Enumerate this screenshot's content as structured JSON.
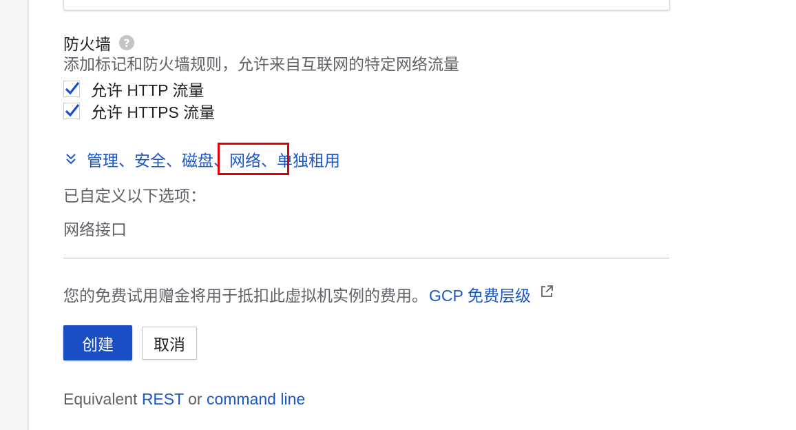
{
  "firewall": {
    "title": "防火墙",
    "help_icon": "help-icon",
    "description": "添加标记和防火墙规则，允许来自互联网的特定网络流量",
    "http_label": "允许 HTTP 流量",
    "http_checked": true,
    "https_label": "允许 HTTPS 流量",
    "https_checked": true
  },
  "advanced": {
    "expander_label": "管理、安全、磁盘、网络、单独租用",
    "chevron_icon": "double-chevron-down-icon",
    "custom_label": "已自定义以下选项：",
    "custom_items": [
      "网络接口"
    ]
  },
  "notice": {
    "text": "您的免费试用赠金将用于抵扣此虚拟机实例的费用。",
    "link_label": "GCP 免费层级",
    "link_icon": "external-link-icon"
  },
  "actions": {
    "create_label": "创建",
    "cancel_label": "取消"
  },
  "equivalent": {
    "prefix": "Equivalent",
    "rest_label": "REST",
    "or_label": "or",
    "cmd_label": "command line"
  },
  "colors": {
    "accent": "#1a57c9",
    "primary_button": "#1a4fc4",
    "highlight": "#e00000"
  }
}
